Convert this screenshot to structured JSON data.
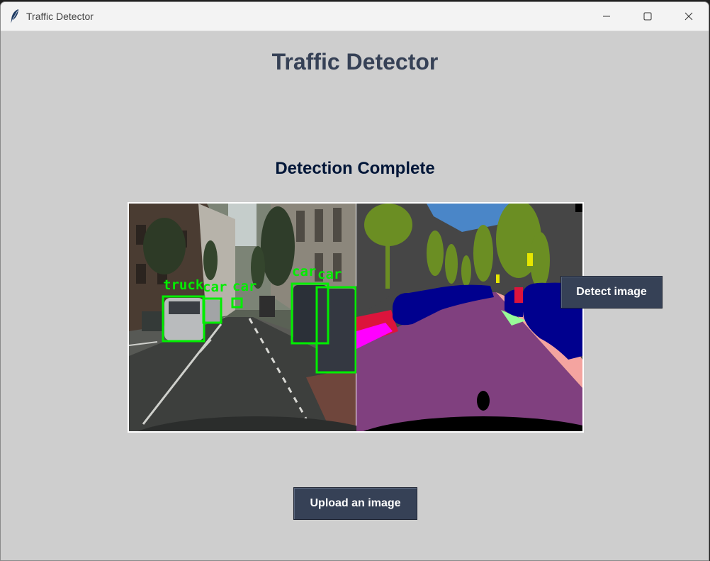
{
  "window": {
    "title": "Traffic Detector",
    "controls": [
      "minimize",
      "maximize",
      "close"
    ]
  },
  "app": {
    "heading": "Traffic Detector",
    "status": "Detection Complete"
  },
  "result_image": {
    "panels": [
      "camera-photo",
      "segmentation-map"
    ],
    "detections": [
      {
        "label": "truck"
      },
      {
        "label": "car"
      },
      {
        "label": "car"
      },
      {
        "label": "car"
      },
      {
        "label": "car"
      }
    ],
    "box_color": "#00ff00"
  },
  "buttons": {
    "detect_label": "Detect image",
    "upload_label": "Upload an image"
  },
  "colors": {
    "background": "#cecece",
    "heading": "#364156",
    "status": "#011638",
    "button": "#364156",
    "button_text": "#ffffff"
  }
}
